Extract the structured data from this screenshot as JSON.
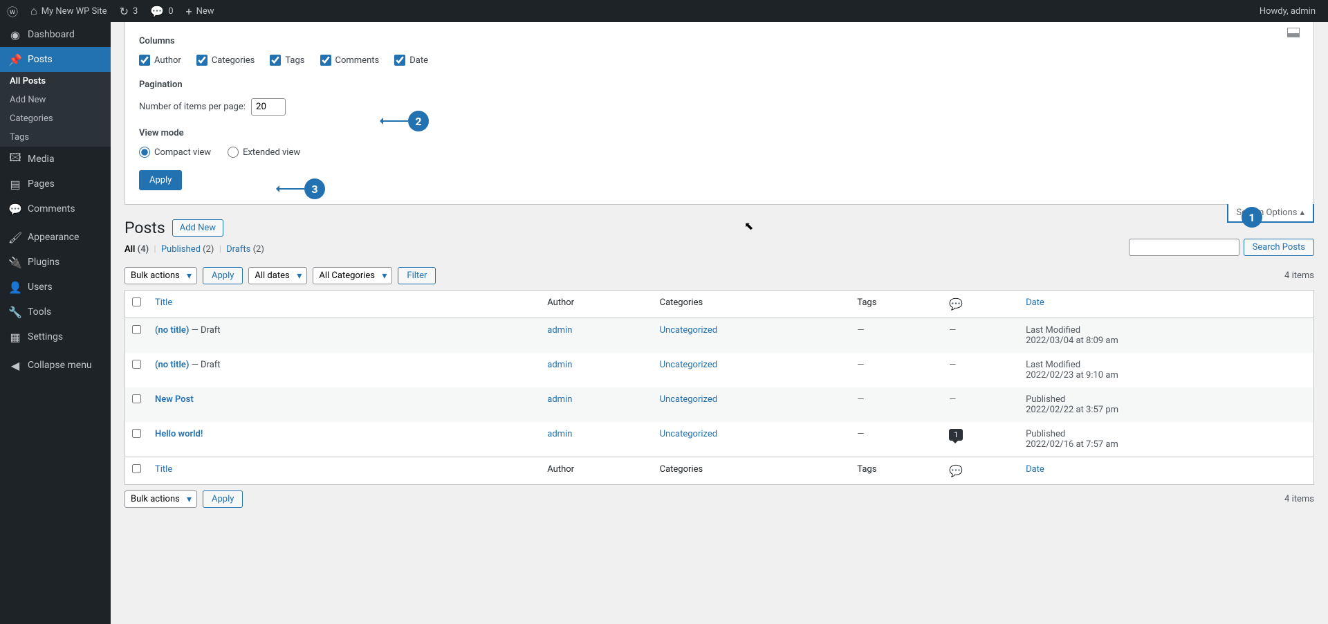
{
  "adminBar": {
    "siteName": "My New WP Site",
    "updates": "3",
    "comments": "0",
    "newLabel": "New",
    "howdy": "Howdy, admin"
  },
  "sidebar": {
    "dashboard": "Dashboard",
    "posts": "Posts",
    "allPosts": "All Posts",
    "addNew": "Add New",
    "categories": "Categories",
    "tags": "Tags",
    "media": "Media",
    "pages": "Pages",
    "comments": "Comments",
    "appearance": "Appearance",
    "plugins": "Plugins",
    "users": "Users",
    "tools": "Tools",
    "settings": "Settings",
    "collapse": "Collapse menu"
  },
  "screenOptions": {
    "columnsTitle": "Columns",
    "author": "Author",
    "categories": "Categories",
    "tags": "Tags",
    "comments": "Comments",
    "date": "Date",
    "paginationTitle": "Pagination",
    "itemsPerPageLabel": "Number of items per page:",
    "itemsPerPageValue": "20",
    "viewModeTitle": "View mode",
    "compactView": "Compact view",
    "extendedView": "Extended view",
    "applyLabel": "Apply",
    "tabLabel": "Screen Options"
  },
  "page": {
    "title": "Posts",
    "addNew": "Add New"
  },
  "filters": {
    "all": "All",
    "allCount": "(4)",
    "published": "Published",
    "publishedCount": "(2)",
    "drafts": "Drafts",
    "draftsCount": "(2)"
  },
  "tablenav": {
    "bulkActions": "Bulk actions",
    "apply": "Apply",
    "allDates": "All dates",
    "allCategories": "All Categories",
    "filter": "Filter",
    "itemsCount": "4 items",
    "searchPosts": "Search Posts"
  },
  "table": {
    "hTitle": "Title",
    "hAuthor": "Author",
    "hCategories": "Categories",
    "hTags": "Tags",
    "hDate": "Date"
  },
  "rows": [
    {
      "title": "(no title)",
      "suffix": " — Draft",
      "author": "admin",
      "category": "Uncategorized",
      "tags": "—",
      "comments": "—",
      "dateStatus": "Last Modified",
      "dateValue": "2022/03/04 at 8:09 am"
    },
    {
      "title": "(no title)",
      "suffix": " — Draft",
      "author": "admin",
      "category": "Uncategorized",
      "tags": "—",
      "comments": "—",
      "dateStatus": "Last Modified",
      "dateValue": "2022/02/23 at 9:10 am"
    },
    {
      "title": "New Post",
      "suffix": "",
      "author": "admin",
      "category": "Uncategorized",
      "tags": "—",
      "comments": "—",
      "dateStatus": "Published",
      "dateValue": "2022/02/22 at 3:57 pm"
    },
    {
      "title": "Hello world!",
      "suffix": "",
      "author": "admin",
      "category": "Uncategorized",
      "tags": "—",
      "comments": "1",
      "dateStatus": "Published",
      "dateValue": "2022/02/16 at 7:57 am"
    }
  ],
  "annotations": {
    "a1": "1",
    "a2": "2",
    "a3": "3"
  }
}
